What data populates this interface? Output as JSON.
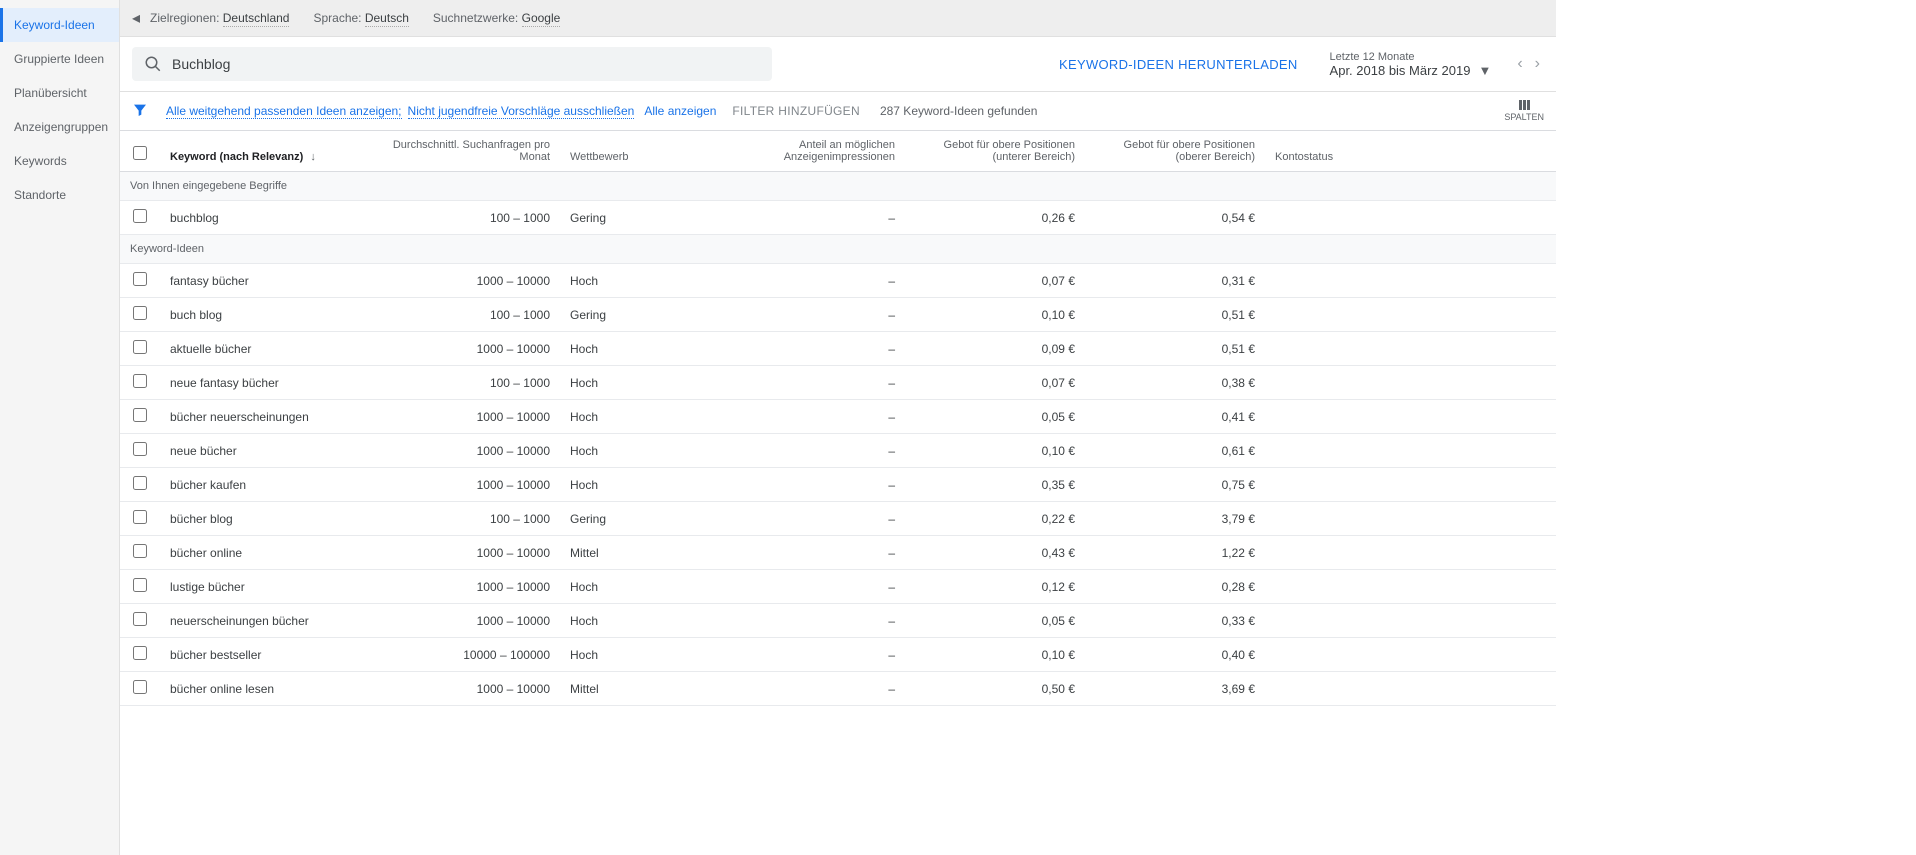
{
  "sidebar": {
    "items": [
      {
        "label": "Keyword-Ideen",
        "active": true
      },
      {
        "label": "Gruppierte Ideen"
      },
      {
        "label": "Planübersicht"
      },
      {
        "label": "Anzeigengruppen"
      },
      {
        "label": "Keywords"
      },
      {
        "label": "Standorte"
      }
    ]
  },
  "topbar": {
    "region_label": "Zielregionen:",
    "region_value": "Deutschland",
    "lang_label": "Sprache:",
    "lang_value": "Deutsch",
    "network_label": "Suchnetzwerke:",
    "network_value": "Google"
  },
  "search": {
    "value": "Buchblog"
  },
  "download_label": "KEYWORD-IDEEN HERUNTERLADEN",
  "daterange": {
    "small": "Letzte 12 Monate",
    "big": "Apr. 2018 bis März 2019"
  },
  "filters": {
    "show_broad": "Alle weitgehend passenden Ideen anzeigen;",
    "exclude_adult": "Nicht jugendfreie Vorschläge ausschließen",
    "show_all": "Alle anzeigen",
    "add_filter": "FILTER HINZUFÜGEN",
    "count_text": "287 Keyword-Ideen gefunden",
    "columns_label": "SPALTEN"
  },
  "table": {
    "headers": {
      "keyword": "Keyword (nach Relevanz)",
      "searches": "Durchschnittl. Suchanfragen pro Monat",
      "competition": "Wettbewerb",
      "impressions": "Anteil an möglichen Anzeigenimpressionen",
      "bid_low": "Gebot für obere Positionen (unterer Bereich)",
      "bid_high": "Gebot für obere Positionen (oberer Bereich)",
      "status": "Kontostatus"
    },
    "section_entered": "Von Ihnen eingegebene Begriffe",
    "section_ideas": "Keyword-Ideen",
    "entered": [
      {
        "kw": "buchblog",
        "searches": "100 – 1000",
        "comp": "Gering",
        "impr": "–",
        "low": "0,26 €",
        "high": "0,54 €"
      }
    ],
    "ideas": [
      {
        "kw": "fantasy bücher",
        "searches": "1000 – 10000",
        "comp": "Hoch",
        "impr": "–",
        "low": "0,07 €",
        "high": "0,31 €"
      },
      {
        "kw": "buch blog",
        "searches": "100 – 1000",
        "comp": "Gering",
        "impr": "–",
        "low": "0,10 €",
        "high": "0,51 €"
      },
      {
        "kw": "aktuelle bücher",
        "searches": "1000 – 10000",
        "comp": "Hoch",
        "impr": "–",
        "low": "0,09 €",
        "high": "0,51 €"
      },
      {
        "kw": "neue fantasy bücher",
        "searches": "100 – 1000",
        "comp": "Hoch",
        "impr": "–",
        "low": "0,07 €",
        "high": "0,38 €"
      },
      {
        "kw": "bücher neuerscheinungen",
        "searches": "1000 – 10000",
        "comp": "Hoch",
        "impr": "–",
        "low": "0,05 €",
        "high": "0,41 €"
      },
      {
        "kw": "neue bücher",
        "searches": "1000 – 10000",
        "comp": "Hoch",
        "impr": "–",
        "low": "0,10 €",
        "high": "0,61 €"
      },
      {
        "kw": "bücher kaufen",
        "searches": "1000 – 10000",
        "comp": "Hoch",
        "impr": "–",
        "low": "0,35 €",
        "high": "0,75 €"
      },
      {
        "kw": "bücher blog",
        "searches": "100 – 1000",
        "comp": "Gering",
        "impr": "–",
        "low": "0,22 €",
        "high": "3,79 €"
      },
      {
        "kw": "bücher online",
        "searches": "1000 – 10000",
        "comp": "Mittel",
        "impr": "–",
        "low": "0,43 €",
        "high": "1,22 €"
      },
      {
        "kw": "lustige bücher",
        "searches": "1000 – 10000",
        "comp": "Hoch",
        "impr": "–",
        "low": "0,12 €",
        "high": "0,28 €"
      },
      {
        "kw": "neuerscheinungen bücher",
        "searches": "1000 – 10000",
        "comp": "Hoch",
        "impr": "–",
        "low": "0,05 €",
        "high": "0,33 €"
      },
      {
        "kw": "bücher bestseller",
        "searches": "10000 – 100000",
        "comp": "Hoch",
        "impr": "–",
        "low": "0,10 €",
        "high": "0,40 €"
      },
      {
        "kw": "bücher online lesen",
        "searches": "1000 – 10000",
        "comp": "Mittel",
        "impr": "–",
        "low": "0,50 €",
        "high": "3,69 €"
      }
    ]
  }
}
